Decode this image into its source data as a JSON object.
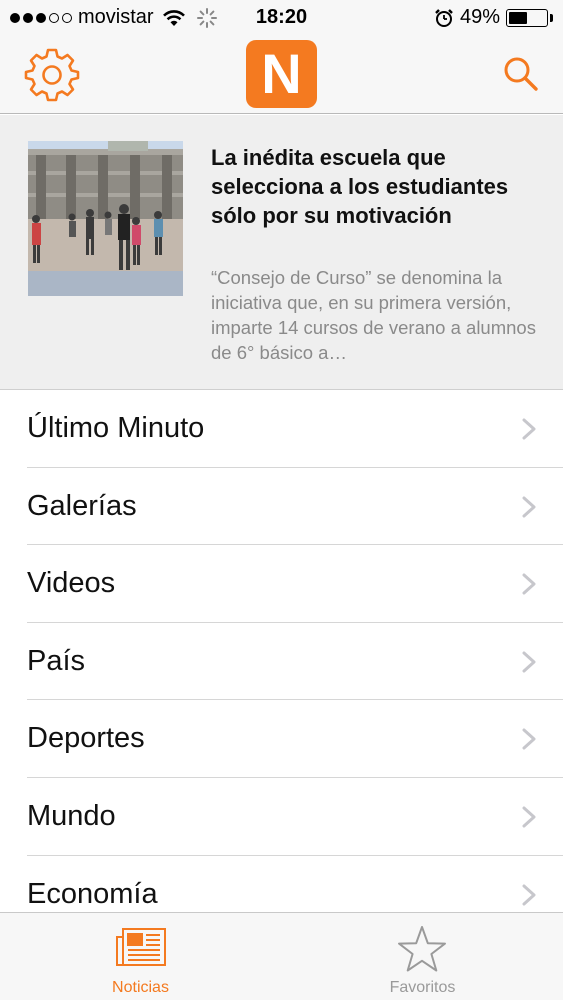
{
  "status_bar": {
    "carrier": "movistar",
    "time": "18:20",
    "battery_percent": "49%",
    "battery_level": 0.49,
    "signal_bars_filled": 3,
    "signal_bars_total": 5
  },
  "nav": {
    "logo_letter": "N",
    "accent_color": "#f47a20"
  },
  "featured": {
    "title": "La inédita escuela que selecciona a los estudiantes sólo por su motivación",
    "summary": "“Consejo de Curso” se denomina la iniciativa que, en su primera versión, imparte 14 cursos de verano a alumnos de 6° básico a…"
  },
  "menu": {
    "items": [
      {
        "label": "Último Minuto"
      },
      {
        "label": "Galerías"
      },
      {
        "label": "Videos"
      },
      {
        "label": "País"
      },
      {
        "label": "Deportes"
      },
      {
        "label": "Mundo"
      },
      {
        "label": "Economía"
      }
    ]
  },
  "tabs": {
    "noticias": "Noticias",
    "favoritos": "Favoritos",
    "active": "noticias"
  }
}
